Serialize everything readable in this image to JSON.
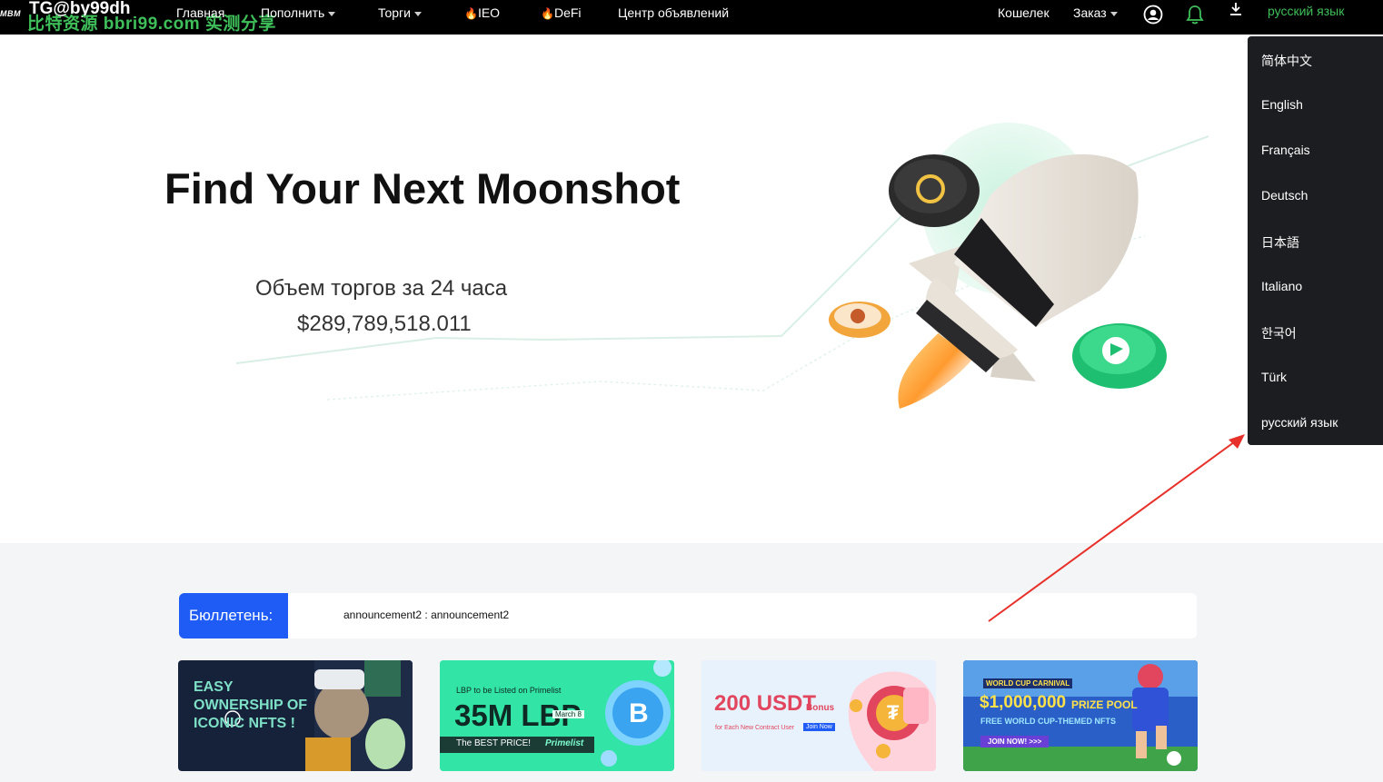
{
  "topbar": {
    "logo": "MBM",
    "watermark_top": "TG@by99dh",
    "watermark_bottom": "比特资源 bbri99.com 实测分享",
    "nav": {
      "home": "Главная",
      "deposit": "Пополнить",
      "trade": "Торги",
      "ieo": "IEO",
      "defi": "DeFi",
      "announcements": "Центр объявлений"
    },
    "wallet": "Кошелек",
    "orders": "Заказ",
    "current_language": "русский язык"
  },
  "hero": {
    "title": "Find Your Next Moonshot",
    "volume_label": "Объем торгов за 24 часа",
    "volume_value": "$289,789,518.011"
  },
  "bulletin": {
    "label": "Бюллетень:",
    "text": "announcement2 : announcement2"
  },
  "banners": [
    {
      "line1": "EASY",
      "line2": "OWNERSHIP OF",
      "line3": "ICONIC NFTS !"
    },
    {
      "top": "LBP to be Listed on Primelist",
      "big": "35M LBP",
      "date": "March 8",
      "bottom": "The BEST PRICE!",
      "brand": "Primelist"
    },
    {
      "big": "200 USDT",
      "bonus": "Bonus",
      "sub": "for Each New Contract User",
      "cta": "Join Now"
    },
    {
      "top": "WORLD CUP CARNIVAL",
      "big": "$1,000,000",
      "prize": "PRIZE POOL",
      "sub": "FREE WORLD CUP-THEMED NFTS",
      "cta": "JOIN NOW! >>>"
    }
  ],
  "language_menu": [
    "简体中文",
    "English",
    "Français",
    "Deutsch",
    "日本語",
    "Italiano",
    "한국어",
    "Türk",
    "русский язык"
  ],
  "colors": {
    "accent_green": "#3fbf5a",
    "bulletin_blue": "#1e5cf5",
    "arrow_red": "#e8302a",
    "menu_bg": "#1c1d21"
  }
}
